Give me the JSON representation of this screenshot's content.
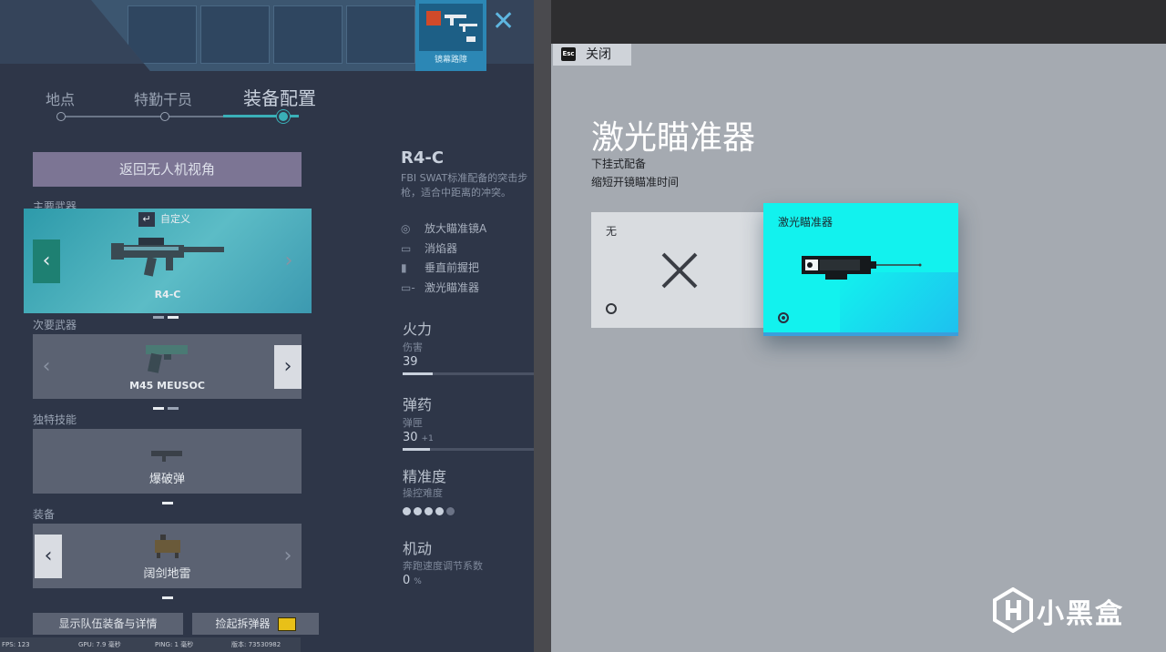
{
  "top": {
    "teammate_name": "镜幕路障"
  },
  "phases": [
    {
      "label": "地点",
      "active": false
    },
    {
      "label": "特勤干员",
      "active": false
    },
    {
      "label": "装备配置",
      "active": true
    }
  ],
  "loadout": {
    "back_to_drone": "返回无人机视角",
    "primary": {
      "section": "主要武器",
      "custom_label": "自定义",
      "weapon": "R4-C"
    },
    "secondary": {
      "section": "次要武器",
      "weapon": "M45 MEUSOC"
    },
    "ability": {
      "section": "独特技能",
      "name": "爆破弹"
    },
    "gadget": {
      "section": "装备",
      "name": "阔剑地雷"
    },
    "buttons": {
      "team_details": "显示队伍装备与详情",
      "pickup_defuser": "捡起拆弹器"
    }
  },
  "weapon_details": {
    "title": "R4-C",
    "description": "FBI SWAT标准配备的突击步枪，适合中距离的冲突。",
    "attachments": [
      "放大瞄准镜A",
      "消焰器",
      "垂直前握把",
      "激光瞄准器"
    ],
    "stats": {
      "firepower": {
        "label": "火力",
        "sub": "伤害",
        "value": "39",
        "fill": 0.22
      },
      "ammo": {
        "label": "弹药",
        "sub": "弹匣",
        "value": "30",
        "extra": "+1",
        "fill": 0.2
      },
      "accuracy": {
        "label": "精准度",
        "sub": "操控难度",
        "pips": 4,
        "pips_total": 5
      },
      "mobility": {
        "label": "机动",
        "sub": "奔跑速度调节系数",
        "value": "0",
        "unit": "%"
      }
    }
  },
  "footer_stats": {
    "fps": "FPS: 123",
    "gpu": "GPU: 7.9",
    "gpu_unit": "毫秒",
    "ping": "PING: 1",
    "ping_unit": "毫秒",
    "version": "版本: 73530982"
  },
  "overlay": {
    "close_key": "Esc",
    "close_label": "关闭",
    "title": "激光瞄准器",
    "subtitle1": "下挂式配备",
    "subtitle2": "缩短开镜瞄准时间",
    "options": [
      {
        "label": "无",
        "selected": false
      },
      {
        "label": "激光瞄准器",
        "selected": true
      }
    ]
  },
  "watermark": {
    "text": "小黑盒"
  },
  "colors": {
    "laser_option_bg": "#12f2ee",
    "overlay_bg": "#a5aab1",
    "scene_bg": "#2e3648",
    "primary_card": "#2d9aaa"
  }
}
